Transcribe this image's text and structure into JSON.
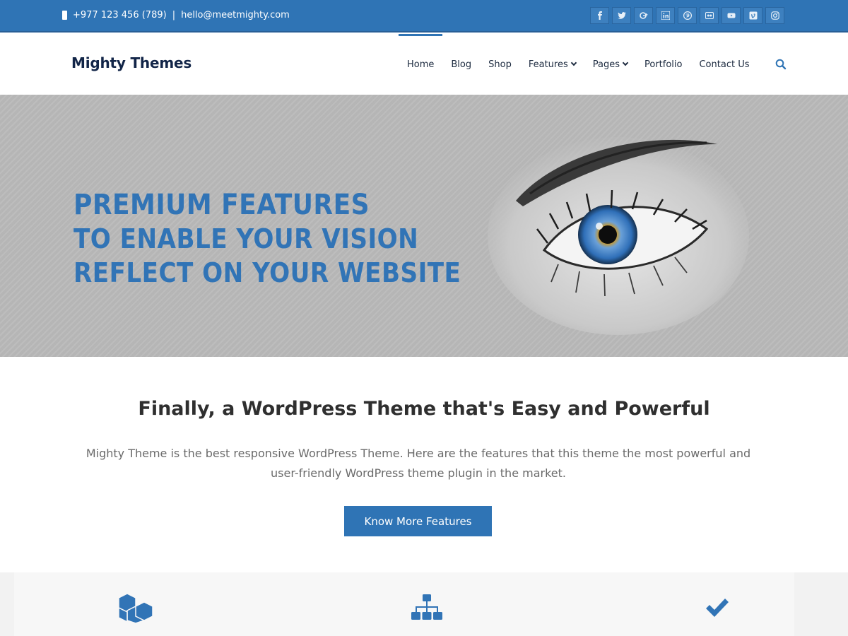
{
  "topbar": {
    "contact": {
      "phone": "+977 123 456 (789)",
      "separator": "|",
      "email": "hello@meetmighty.com"
    },
    "socials": [
      "facebook-icon",
      "twitter-icon",
      "google-plus-icon",
      "linkedin-icon",
      "pinterest-icon",
      "flickr-icon",
      "youtube-icon",
      "vimeo-icon",
      "instagram-icon"
    ]
  },
  "header": {
    "brand": "Mighty Themes",
    "nav": [
      {
        "label": "Home",
        "active": true
      },
      {
        "label": "Blog"
      },
      {
        "label": "Shop"
      },
      {
        "label": "Features",
        "dropdown": true
      },
      {
        "label": "Pages",
        "dropdown": true
      },
      {
        "label": "Portfolio"
      },
      {
        "label": "Contact Us"
      }
    ],
    "search_icon": "search-icon"
  },
  "hero": {
    "lines": [
      "Premium Features",
      "to enable your vision",
      "reflect on your website"
    ]
  },
  "intro": {
    "title": "Finally, a WordPress Theme that's Easy and Powerful",
    "text": "Mighty Theme is the best responsive WordPress Theme. Here are the features that this theme the most powerful and user-friendly WordPress theme plugin in the market.",
    "cta_label": "Know More Features"
  },
  "features": {
    "icons": [
      "cubes-icon",
      "sitemap-icon",
      "check-icon"
    ]
  },
  "colors": {
    "brand_blue": "#2f74b5",
    "hero_text": "#3174b6",
    "heading": "#2f2f2f",
    "body_text": "#6a6a6a"
  }
}
